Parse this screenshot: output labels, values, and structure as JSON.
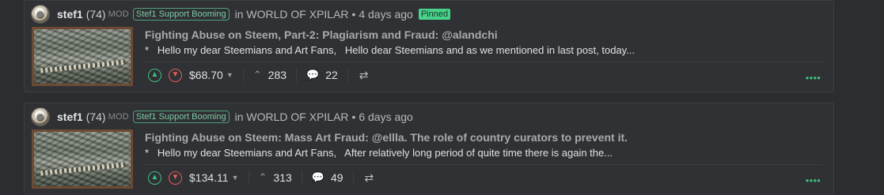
{
  "posts": [
    {
      "author": "stef1",
      "reputation": "(74)",
      "mod_label": "MOD",
      "role": "Stef1 Support Booming",
      "community": "in WORLD OF XPILAR",
      "time": "• 4 days ago",
      "badge": "Pinned",
      "title": "Fighting Abuse on Steem, Part-2: Plagiarism and Fraud: @alandchi",
      "excerpt": "*   Hello my dear Steemians and Art Fans,   Hello dear Steemians and as we mentioned in last post, today...",
      "payout": "$68.70",
      "votes": "283",
      "comments": "22"
    },
    {
      "author": "stef1",
      "reputation": "(74)",
      "mod_label": "MOD",
      "role": "Stef1 Support Booming",
      "community": "in WORLD OF XPILAR",
      "time": "• 6 days ago",
      "title": "Fighting Abuse on Steem: Mass Art Fraud: @ellla. The role of country curators to prevent it.",
      "excerpt": "*   Hello my dear Steemians and Art Fans,   After relatively long period of quite time there is again the...",
      "payout": "$134.11",
      "votes": "313",
      "comments": "49"
    }
  ],
  "icons": {
    "upvote": "chevron-up-icon",
    "downvote": "chevron-down-icon",
    "votes": "caret-up-icon",
    "comments": "comments-icon",
    "resteem": "resteem-icon",
    "menu": "dots-icon"
  },
  "colors": {
    "background": "#2b2d31",
    "card": "#2f3134",
    "accent_green": "#3fbf7f",
    "downvote_red": "#e05c5c",
    "pinned_badge": "#47d28a"
  }
}
